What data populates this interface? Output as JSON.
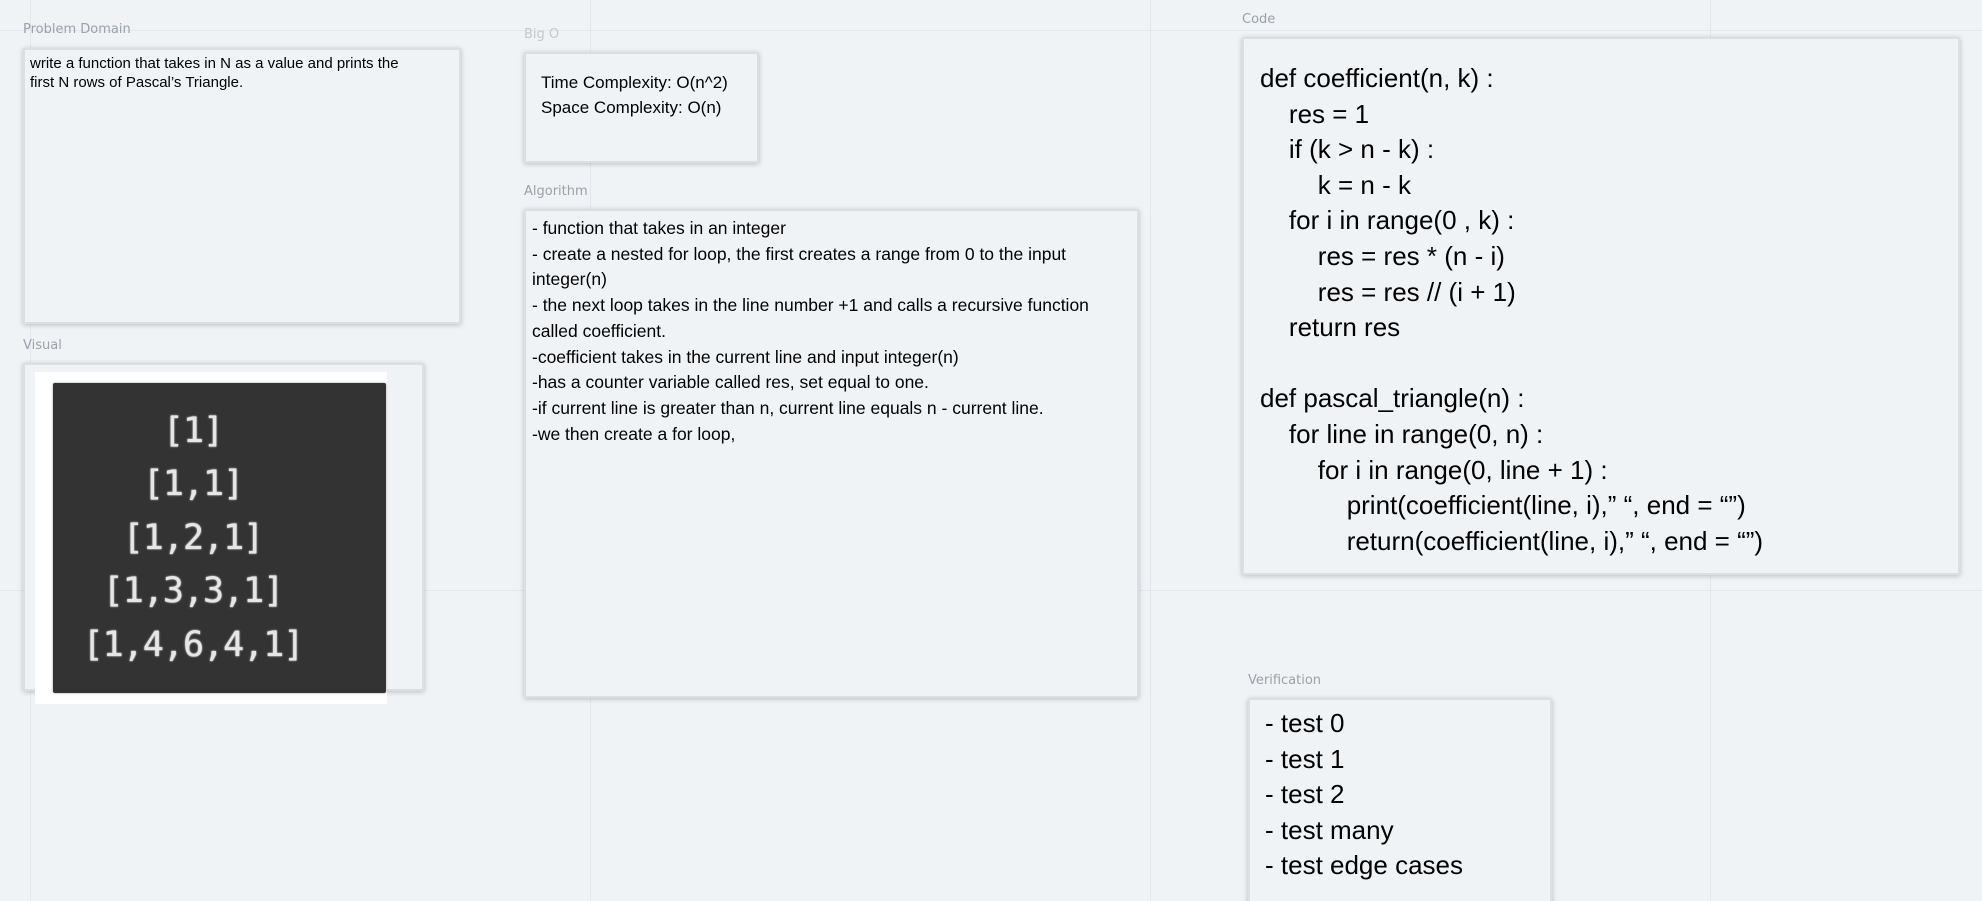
{
  "frames": {
    "problem": {
      "title": "Problem Domain",
      "text": "write a function that takes in N as a value and prints the\nfirst N rows of Pascal’s Triangle."
    },
    "big_o": {
      "title": "Big O",
      "lines": [
        "Time Complexity: O(n^2)",
        "Space Complexity: O(n)"
      ]
    },
    "algorithm": {
      "title": "Algorithm",
      "lines": [
        "- function that takes in an integer",
        "- create a nested for loop, the first creates a range from 0 to the input",
        "integer(n)",
        "- the next loop takes in the line number +1 and calls a recursive function",
        "called coefficient.",
        "-coefficient takes in the current line and input integer(n)",
        "-has a counter variable called res, set equal to one.",
        "-if current line is greater than n, current line equals n - current line.",
        "-we then create a for loop,"
      ]
    },
    "code": {
      "title": "Code",
      "lines": [
        "def coefficient(n, k) :",
        "    res = 1",
        "    if (k > n - k) :",
        "        k = n - k",
        "    for i in range(0 , k) :",
        "        res = res * (n - i)",
        "        res = res // (i + 1)",
        "    return res",
        "",
        "def pascal_triangle(n) :",
        "    for line in range(0, n) :",
        "        for i in range(0, line + 1) :",
        "            print(coefficient(line, i),” “, end = “”)",
        "            return(coefficient(line, i),” “, end = “”)"
      ]
    },
    "visual": {
      "title": "Visual",
      "rows": [
        "[1]",
        "[1,1]",
        "[1,2,1]",
        "[1,3,3,1]",
        "[1,4,6,4,1]"
      ]
    },
    "verification": {
      "title": "Verification",
      "items": [
        "- test 0",
        "- test 1",
        "- test 2",
        "- test many",
        "- test edge cases"
      ]
    }
  }
}
